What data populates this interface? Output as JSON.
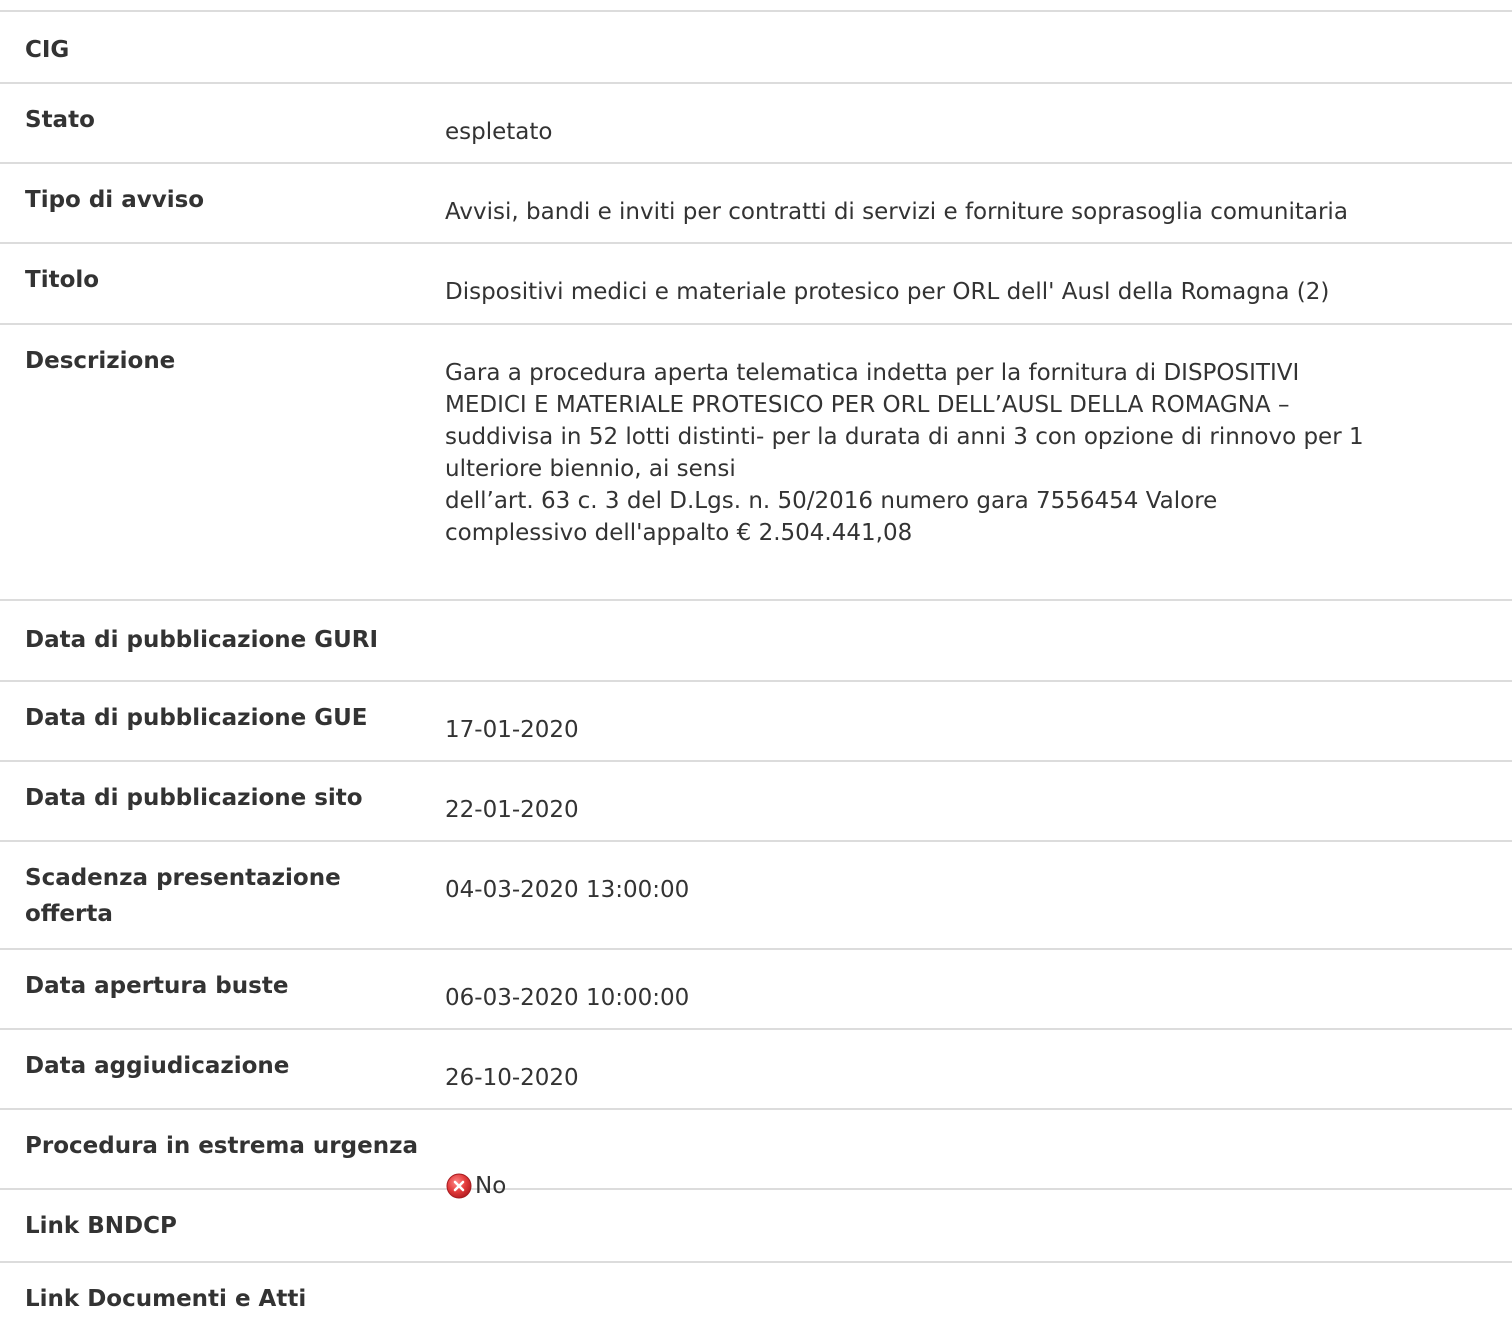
{
  "rows": [
    {
      "label": "CIG",
      "value": ""
    },
    {
      "label": "Stato",
      "value": "espletato"
    },
    {
      "label": "Tipo di avviso",
      "value": "Avvisi, bandi e inviti per contratti di servizi e forniture soprasoglia comunitaria"
    },
    {
      "label": "Titolo",
      "value": "Dispositivi medici e materiale protesico per ORL dell' Ausl della Romagna (2)"
    },
    {
      "label": "Descrizione",
      "value": "Gara a procedura aperta telematica indetta per la fornitura di DISPOSITIVI\nMEDICI E MATERIALE PROTESICO PER ORL DELL’AUSL DELLA ROMAGNA –\nsuddivisa in 52 lotti distinti- per la durata di anni 3 con opzione di rinnovo per 1\nulteriore biennio, ai sensi\ndell’art. 63 c. 3 del D.Lgs. n. 50/2016 numero gara 7556454 Valore\ncomplessivo dell'appalto € 2.504.441,08"
    },
    {
      "label": "Data di pubblicazione GURI",
      "value": ""
    },
    {
      "label": "Data di pubblicazione GUE",
      "value": "17-01-2020"
    },
    {
      "label": "Data di pubblicazione sito",
      "value": "22-01-2020"
    },
    {
      "label": "Scadenza presentazione\nofferta",
      "value": "04-03-2020 13:00:00"
    },
    {
      "label": "Data apertura buste",
      "value": "06-03-2020 10:00:00"
    },
    {
      "label": "Data aggiudicazione",
      "value": "26-10-2020"
    },
    {
      "label": "Procedura in estrema urgenza",
      "value": "No",
      "icon": "no-circle-icon",
      "icon_color": "#d9363e"
    },
    {
      "label": "Link BNDCP",
      "value": ""
    },
    {
      "label": "Link Documenti e Atti",
      "value": ""
    }
  ]
}
